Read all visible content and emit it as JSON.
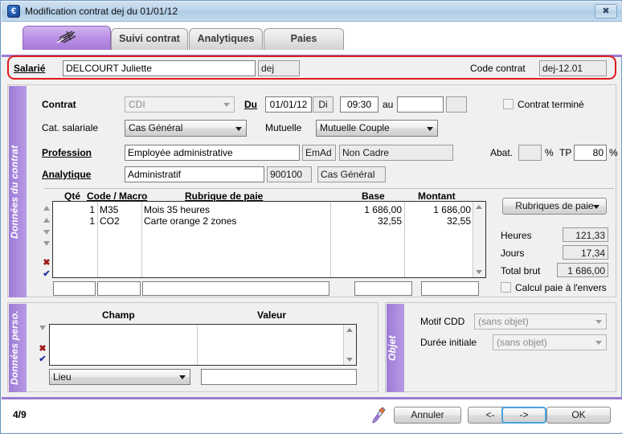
{
  "window": {
    "title": "Modification contrat dej du 01/01/12",
    "icon": "euro-app-icon",
    "close_label": "✖"
  },
  "tabs": [
    {
      "label": "",
      "icon": "contract-feather-icon",
      "active": true
    },
    {
      "label": "Suivi contrat",
      "active": false
    },
    {
      "label": "Analytiques",
      "active": false
    },
    {
      "label": "Paies",
      "active": false
    }
  ],
  "header": {
    "salarie_label": "Salarié",
    "salarie_value": "DELCOURT Juliette",
    "salarie_code": "dej",
    "code_contrat_label": "Code contrat",
    "code_contrat_value": "dej-12.01"
  },
  "side_bands": {
    "contract": "Données du contrat",
    "personal": "Données perso.",
    "object": "Objet"
  },
  "contract": {
    "contrat_label": "Contrat",
    "contrat_value": "CDI",
    "du_label": "Du",
    "du_date": "01/01/12",
    "du_day": "Di",
    "du_time": "09:30",
    "au_label": "au",
    "au_date": "",
    "au_day": "",
    "termine_label": "Contrat terminé",
    "cat_label": "Cat. salariale",
    "cat_value": "Cas Général",
    "mutuelle_label": "Mutuelle",
    "mutuelle_value": "Mutuelle Couple",
    "profession_label": "Profession",
    "profession_value": "Employée administrative",
    "profession_code": "EmAd",
    "profession_statut": "Non Cadre",
    "abat_label": "Abat.",
    "abat_value": "",
    "abat_pct": "%",
    "tp_label": "TP",
    "tp_value": "80",
    "tp_pct": "%",
    "analytique_label": "Analytique",
    "analytique_value": "Administratif",
    "analytique_code": "900100",
    "analytique_cat": "Cas Général"
  },
  "rubriques_grid": {
    "columns": [
      "Qté",
      "Code / Macro",
      "Rubrique de paie",
      "Base",
      "Montant"
    ],
    "rows": [
      {
        "qte": "1",
        "code": "M35",
        "rubrique": "Mois 35 heures",
        "base": "1 686,00",
        "montant": "1 686,00"
      },
      {
        "qte": "1",
        "code": "CO2",
        "rubrique": "Carte orange 2 zones",
        "base": "32,55",
        "montant": "32,55"
      }
    ],
    "entry_row": {
      "qte": "",
      "code": "",
      "rubrique": "",
      "base": "",
      "montant": ""
    },
    "tools": [
      "move-top-icon",
      "move-up-icon",
      "move-down-icon",
      "move-bottom-icon",
      "delete-row-icon",
      "validate-row-icon"
    ]
  },
  "totals": {
    "rubriques_button": "Rubriques de paie",
    "heures_label": "Heures",
    "heures_value": "121,33",
    "jours_label": "Jours",
    "jours_value": "17,34",
    "total_brut_label": "Total brut",
    "total_brut_value": "1 686,00",
    "envers_label": "Calcul paie à l'envers"
  },
  "perso": {
    "col_champ": "Champ",
    "col_valeur": "Valeur",
    "rows": [],
    "field_select": "Lieu",
    "field_value": "",
    "tools": [
      "move-down-icon",
      "delete-row-icon",
      "validate-row-icon"
    ]
  },
  "objet": {
    "motif_label": "Motif CDD",
    "motif_value": "(sans objet)",
    "duree_label": "Durée initiale",
    "duree_value": "(sans objet)"
  },
  "footer": {
    "pager": "4/9",
    "pencil_icon": "edit-pencil-icon",
    "cancel": "Annuler",
    "prev": "<-",
    "next": "->",
    "ok": "OK"
  },
  "colors": {
    "accent_purple": "#9b7ad1",
    "band_purple": "#a98ade",
    "highlight_red": "#e01b1b",
    "focus_blue": "#4aa3e0",
    "title_blue": "#aecbe5"
  }
}
